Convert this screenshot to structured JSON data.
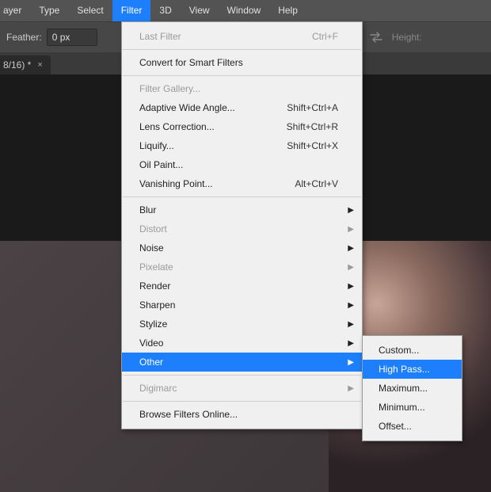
{
  "menubar": {
    "items": [
      {
        "label": "ayer",
        "partial": true
      },
      {
        "label": "Type"
      },
      {
        "label": "Select"
      },
      {
        "label": "Filter",
        "open": true
      },
      {
        "label": "3D"
      },
      {
        "label": "View"
      },
      {
        "label": "Window"
      },
      {
        "label": "Help"
      }
    ]
  },
  "optionsbar": {
    "feather_label": "Feather:",
    "feather_value": "0 px",
    "height_label": "Height:"
  },
  "tab": {
    "title": "8/16) *",
    "close": "×"
  },
  "filter_menu": [
    {
      "type": "pad"
    },
    {
      "type": "item",
      "label": "Last Filter",
      "shortcut": "Ctrl+F",
      "disabled": true
    },
    {
      "type": "sep"
    },
    {
      "type": "item",
      "label": "Convert for Smart Filters"
    },
    {
      "type": "sep"
    },
    {
      "type": "item",
      "label": "Filter Gallery...",
      "disabled": true
    },
    {
      "type": "item",
      "label": "Adaptive Wide Angle...",
      "shortcut": "Shift+Ctrl+A"
    },
    {
      "type": "item",
      "label": "Lens Correction...",
      "shortcut": "Shift+Ctrl+R"
    },
    {
      "type": "item",
      "label": "Liquify...",
      "shortcut": "Shift+Ctrl+X"
    },
    {
      "type": "item",
      "label": "Oil Paint..."
    },
    {
      "type": "item",
      "label": "Vanishing Point...",
      "shortcut": "Alt+Ctrl+V"
    },
    {
      "type": "sep"
    },
    {
      "type": "item",
      "label": "Blur",
      "sub": true
    },
    {
      "type": "item",
      "label": "Distort",
      "sub": true,
      "disabled": true
    },
    {
      "type": "item",
      "label": "Noise",
      "sub": true
    },
    {
      "type": "item",
      "label": "Pixelate",
      "sub": true,
      "disabled": true
    },
    {
      "type": "item",
      "label": "Render",
      "sub": true
    },
    {
      "type": "item",
      "label": "Sharpen",
      "sub": true
    },
    {
      "type": "item",
      "label": "Stylize",
      "sub": true
    },
    {
      "type": "item",
      "label": "Video",
      "sub": true
    },
    {
      "type": "item",
      "label": "Other",
      "sub": true,
      "highlight": true
    },
    {
      "type": "sep"
    },
    {
      "type": "item",
      "label": "Digimarc",
      "sub": true,
      "disabled": true
    },
    {
      "type": "sep"
    },
    {
      "type": "item",
      "label": "Browse Filters Online..."
    },
    {
      "type": "pad"
    }
  ],
  "other_submenu": [
    {
      "label": "Custom..."
    },
    {
      "label": "High Pass...",
      "highlight": true
    },
    {
      "label": "Maximum..."
    },
    {
      "label": "Minimum..."
    },
    {
      "label": "Offset..."
    }
  ],
  "glyphs": {
    "arrow": "▶"
  }
}
